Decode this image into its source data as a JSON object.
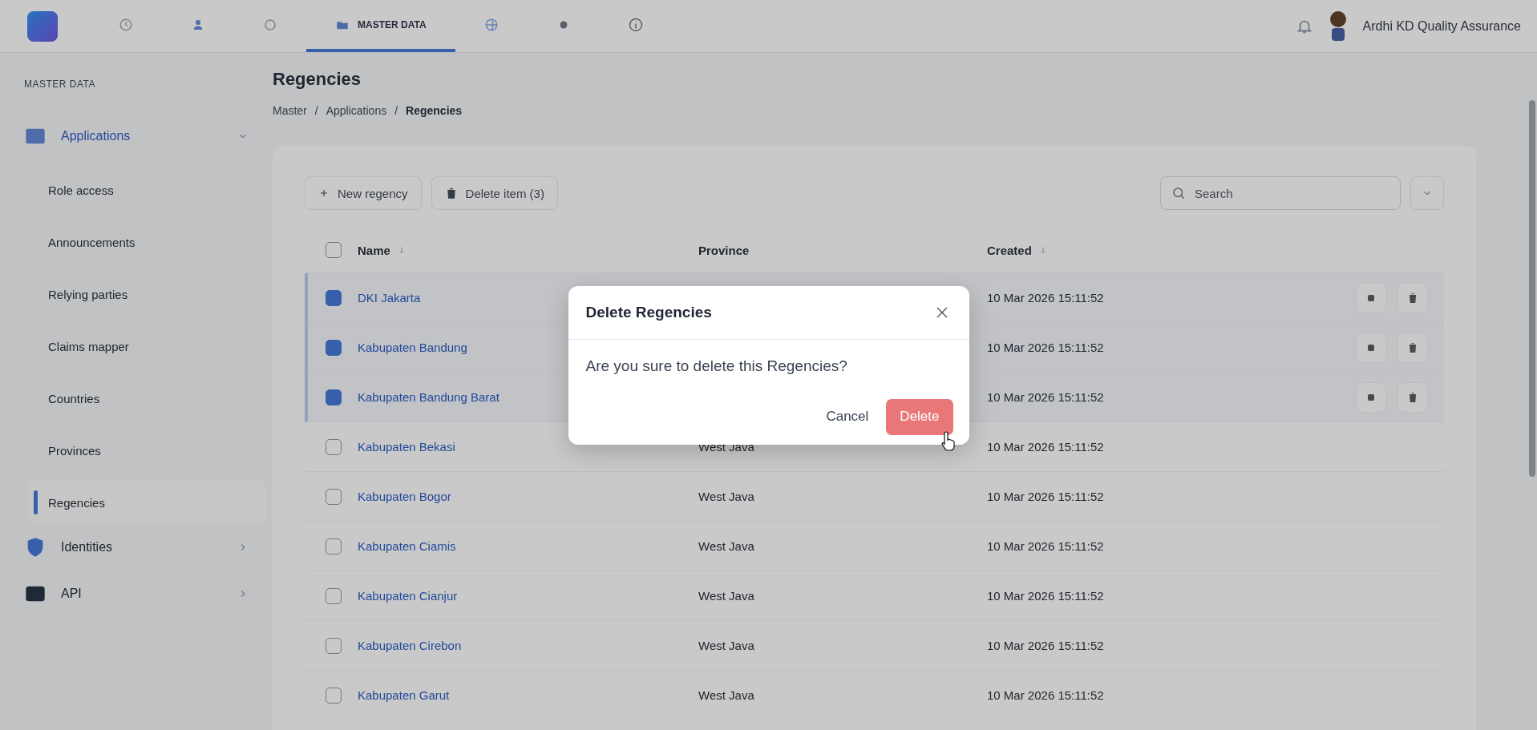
{
  "topbar": {
    "nav": [
      {
        "selected": false
      },
      {
        "selected": false
      },
      {
        "selected": false
      },
      {
        "label": "MASTER DATA",
        "selected": true
      },
      {
        "selected": false
      },
      {
        "selected": false
      },
      {
        "selected": false
      }
    ],
    "user": {
      "name": "Ardhi KD Quality Assurance"
    }
  },
  "sidebar": {
    "heading": "MASTER DATA",
    "groups": [
      {
        "label": "Applications",
        "expanded": true,
        "children": [
          {
            "label": "Role access",
            "selected": false
          },
          {
            "label": "Announcements",
            "selected": false
          },
          {
            "label": "Relying parties",
            "selected": false
          },
          {
            "label": "Claims mapper",
            "selected": false
          },
          {
            "label": "Countries",
            "selected": false
          },
          {
            "label": "Provinces",
            "selected": false
          },
          {
            "label": "Regencies",
            "selected": true
          }
        ]
      },
      {
        "label": "Identities",
        "expanded": false
      },
      {
        "label": "API",
        "expanded": false
      }
    ]
  },
  "page": {
    "title": "Regencies",
    "breadcrumb": [
      "Master",
      "Applications",
      "Regencies"
    ],
    "separator": "/"
  },
  "toolbar": {
    "buttons": [
      {
        "label": "New regency"
      },
      {
        "label": "Delete item (3)"
      }
    ],
    "search": {
      "placeholder": "Search"
    }
  },
  "table": {
    "select_all": {
      "checked": false
    },
    "columns": [
      "Name",
      "Province",
      "Created"
    ],
    "rows": [
      {
        "name": "DKI Jakarta",
        "created": "10 Mar 2026 15:11:52",
        "selected": true
      },
      {
        "name": "Kabupaten Bandung",
        "created": "10 Mar 2026 15:11:52",
        "selected": true
      },
      {
        "name": "Kabupaten Bandung Barat",
        "created": "10 Mar 2026 15:11:52",
        "selected": true
      },
      {
        "name": "Kabupaten Bekasi",
        "province": "West Java",
        "created": "10 Mar 2026 15:11:52",
        "selected": false
      },
      {
        "name": "Kabupaten Bogor",
        "province": "West Java",
        "created": "10 Mar 2026 15:11:52",
        "selected": false
      },
      {
        "name": "Kabupaten Ciamis",
        "province": "West Java",
        "created": "10 Mar 2026 15:11:52",
        "selected": false
      },
      {
        "name": "Kabupaten Cianjur",
        "province": "West Java",
        "created": "10 Mar 2026 15:11:52",
        "selected": false
      },
      {
        "name": "Kabupaten Cirebon",
        "province": "West Java",
        "created": "10 Mar 2026 15:11:52",
        "selected": false
      },
      {
        "name": "Kabupaten Garut",
        "province": "West Java",
        "created": "10 Mar 2026 15:11:52",
        "selected": false
      }
    ]
  },
  "dialog": {
    "title": "Delete Regencies",
    "message": "Are you sure to delete this Regencies?",
    "cancel": "Cancel",
    "confirm": "Delete"
  }
}
